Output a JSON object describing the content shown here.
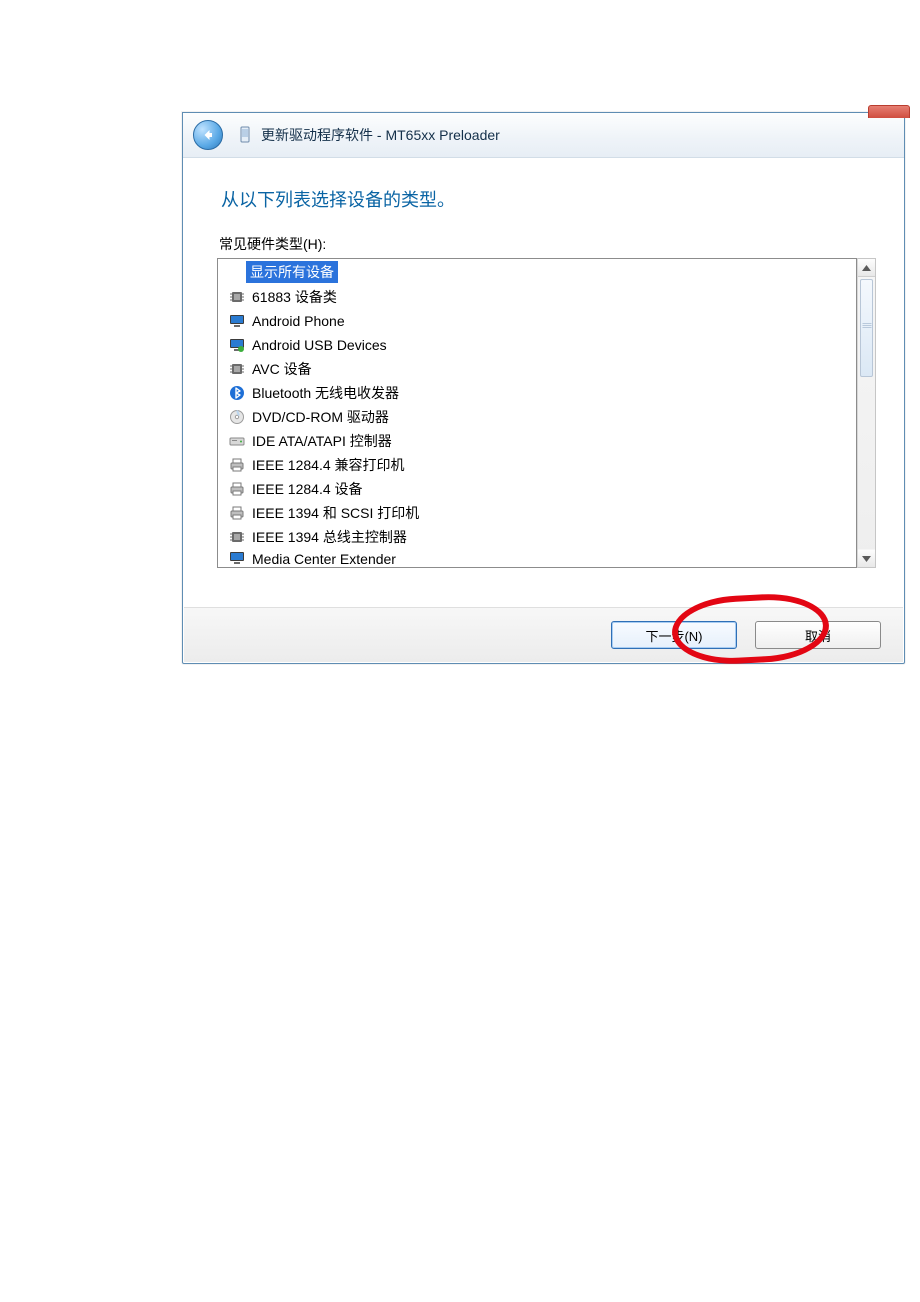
{
  "title": "更新驱动程序软件 - MT65xx Preloader",
  "subtitle": "从以下列表选择设备的类型。",
  "list_label": "常见硬件类型(H):",
  "items": [
    {
      "label": "显示所有设备",
      "icon": "none",
      "selected": true
    },
    {
      "label": "61883 设备类",
      "icon": "chip"
    },
    {
      "label": "Android Phone",
      "icon": "monitor"
    },
    {
      "label": "Android USB Devices",
      "icon": "usb"
    },
    {
      "label": "AVC 设备",
      "icon": "chip"
    },
    {
      "label": "Bluetooth 无线电收发器",
      "icon": "bluetooth"
    },
    {
      "label": "DVD/CD-ROM 驱动器",
      "icon": "disc"
    },
    {
      "label": "IDE ATA/ATAPI 控制器",
      "icon": "drive"
    },
    {
      "label": "IEEE 1284.4 兼容打印机",
      "icon": "printer"
    },
    {
      "label": "IEEE 1284.4 设备",
      "icon": "printer"
    },
    {
      "label": "IEEE 1394 和 SCSI 打印机",
      "icon": "printer"
    },
    {
      "label": "IEEE 1394 总线主控制器",
      "icon": "chip"
    },
    {
      "label": "Media Center Extender",
      "icon": "monitor"
    }
  ],
  "buttons": {
    "next": "下一步(N)",
    "cancel": "取消"
  }
}
